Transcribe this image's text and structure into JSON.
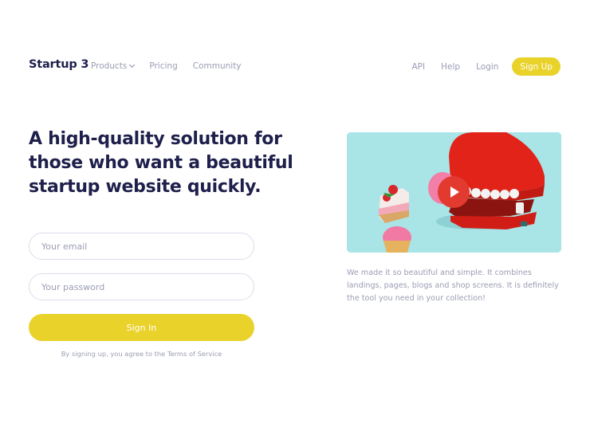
{
  "header": {
    "brand": "Startup 3",
    "nav_left": [
      {
        "label": "Products",
        "has_dropdown": true
      },
      {
        "label": "Pricing"
      },
      {
        "label": "Community"
      }
    ],
    "nav_right": [
      {
        "label": "API"
      },
      {
        "label": "Help"
      },
      {
        "label": "Login"
      }
    ],
    "signup_label": "Sign Up"
  },
  "hero": {
    "headline": "A high-quality solution for those who want a beautiful startup website quickly.",
    "email_placeholder": "Your email",
    "password_placeholder": "Your password",
    "signin_label": "Sign In",
    "terms_text": "By signing up, you agree to the Terms of Service"
  },
  "media": {
    "image_description": "Red wind-up chattering teeth toy with a pink donut, strawberry cake slice and pink cupcake on light blue background",
    "play_icon": "play-icon",
    "description": "We made it so beautiful and simple. It combines landings, pages, blogs and shop screens. It is definitely the tool you need in your collection!"
  },
  "colors": {
    "accent": "#e9d22a",
    "heading": "#1e1f4b",
    "muted": "#9a9db3",
    "play": "#e23a2f",
    "image_bg": "#a9e4e6"
  }
}
